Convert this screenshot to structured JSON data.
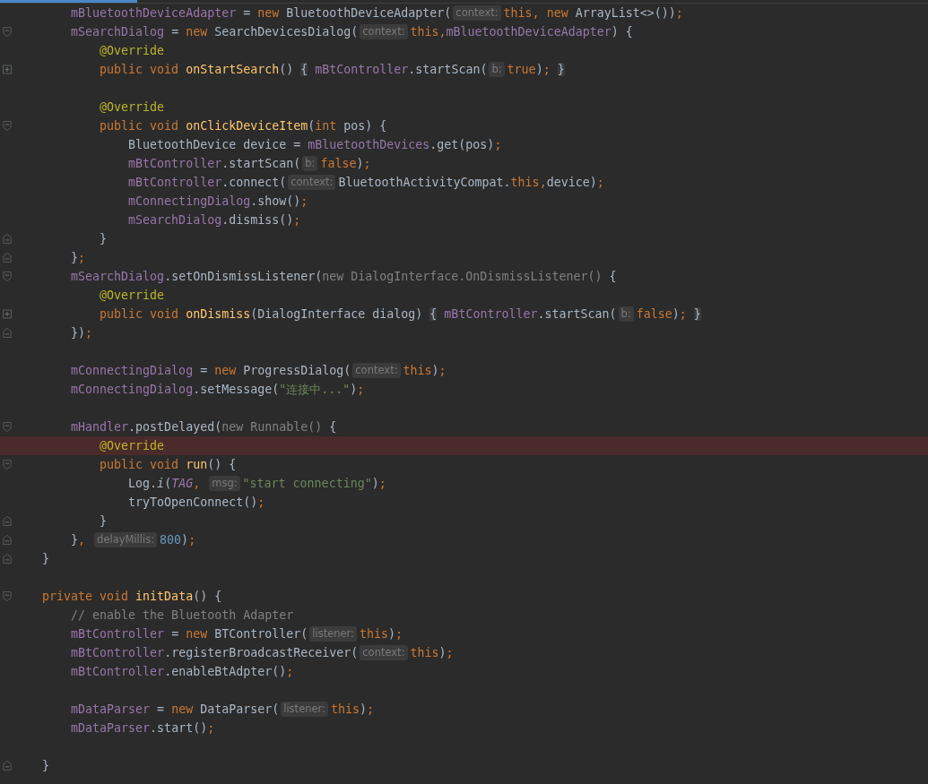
{
  "editor": {
    "lines": [
      {
        "highlighted": false,
        "tokens": [
          {
            "kind": "field",
            "text": "        mBluetoothDeviceAdapter"
          },
          {
            "kind": "plain",
            "text": " = "
          },
          {
            "kind": "keyword",
            "text": "new "
          },
          {
            "kind": "plain",
            "text": "BluetoothDeviceAdapter("
          },
          {
            "kind": "hint",
            "text": "context:"
          },
          {
            "kind": "keyword",
            "text": "this"
          },
          {
            "kind": "punct",
            "text": ", "
          },
          {
            "kind": "keyword",
            "text": "new "
          },
          {
            "kind": "plain",
            "text": "ArrayList<>())"
          },
          {
            "kind": "punct",
            "text": ";"
          }
        ]
      },
      {
        "fold_marker": {
          "kind": "start"
        },
        "highlighted": false,
        "tokens": [
          {
            "kind": "field",
            "text": "        mSearchDialog"
          },
          {
            "kind": "plain",
            "text": " = "
          },
          {
            "kind": "keyword",
            "text": "new "
          },
          {
            "kind": "plain",
            "text": "SearchDevicesDialog("
          },
          {
            "kind": "hint",
            "text": "context:"
          },
          {
            "kind": "keyword",
            "text": "this"
          },
          {
            "kind": "punct",
            "text": ","
          },
          {
            "kind": "field",
            "text": "mBluetoothDeviceAdapter"
          },
          {
            "kind": "plain",
            "text": ") {"
          }
        ]
      },
      {
        "highlighted": false,
        "tokens": [
          {
            "kind": "annotation",
            "text": "            @Override"
          }
        ]
      },
      {
        "fold_marker": {
          "kind": "collapsed"
        },
        "highlighted": false,
        "tokens": [
          {
            "kind": "keyword",
            "text": "            public void "
          },
          {
            "kind": "method",
            "text": "onStartSearch"
          },
          {
            "kind": "plain",
            "text": "() "
          },
          {
            "kind": "fold",
            "text": "{"
          },
          {
            "kind": "field",
            "text": " mBtController"
          },
          {
            "kind": "plain",
            "text": ".startScan("
          },
          {
            "kind": "hint",
            "text": "b:"
          },
          {
            "kind": "keyword",
            "text": "true"
          },
          {
            "kind": "plain",
            "text": ")"
          },
          {
            "kind": "punct",
            "text": "; "
          },
          {
            "kind": "fold",
            "text": "}"
          }
        ]
      },
      {
        "highlighted": false
      },
      {
        "highlighted": false,
        "tokens": [
          {
            "kind": "annotation",
            "text": "            @Override"
          }
        ]
      },
      {
        "fold_marker": {
          "kind": "start"
        },
        "highlighted": false,
        "tokens": [
          {
            "kind": "keyword",
            "text": "            public void "
          },
          {
            "kind": "method",
            "text": "onClickDeviceItem"
          },
          {
            "kind": "plain",
            "text": "("
          },
          {
            "kind": "keyword",
            "text": "int "
          },
          {
            "kind": "plain",
            "text": "pos) {"
          }
        ]
      },
      {
        "highlighted": false,
        "tokens": [
          {
            "kind": "plain",
            "text": "                BluetoothDevice device = "
          },
          {
            "kind": "field",
            "text": "mBluetoothDevices"
          },
          {
            "kind": "plain",
            "text": ".get(pos)"
          },
          {
            "kind": "punct",
            "text": ";"
          }
        ]
      },
      {
        "highlighted": false,
        "tokens": [
          {
            "kind": "field",
            "text": "                mBtController"
          },
          {
            "kind": "plain",
            "text": ".startScan("
          },
          {
            "kind": "hint",
            "text": "b:"
          },
          {
            "kind": "keyword",
            "text": "false"
          },
          {
            "kind": "plain",
            "text": ")"
          },
          {
            "kind": "punct",
            "text": ";"
          }
        ]
      },
      {
        "highlighted": false,
        "tokens": [
          {
            "kind": "field",
            "text": "                mBtController"
          },
          {
            "kind": "plain",
            "text": ".connect("
          },
          {
            "kind": "hint",
            "text": "context:"
          },
          {
            "kind": "plain",
            "text": "BluetoothActivityCompat."
          },
          {
            "kind": "keyword",
            "text": "this"
          },
          {
            "kind": "punct",
            "text": ","
          },
          {
            "kind": "plain",
            "text": "device)"
          },
          {
            "kind": "punct",
            "text": ";"
          }
        ]
      },
      {
        "highlighted": false,
        "tokens": [
          {
            "kind": "field",
            "text": "                mConnectingDialog"
          },
          {
            "kind": "plain",
            "text": ".show()"
          },
          {
            "kind": "punct",
            "text": ";"
          }
        ]
      },
      {
        "highlighted": false,
        "tokens": [
          {
            "kind": "field",
            "text": "                mSearchDialog"
          },
          {
            "kind": "plain",
            "text": ".dismiss()"
          },
          {
            "kind": "punct",
            "text": ";"
          }
        ]
      },
      {
        "fold_marker": {
          "kind": "end"
        },
        "highlighted": false,
        "tokens": [
          {
            "kind": "plain",
            "text": "            }"
          }
        ]
      },
      {
        "fold_marker": {
          "kind": "end"
        },
        "highlighted": false,
        "tokens": [
          {
            "kind": "plain",
            "text": "        }"
          },
          {
            "kind": "punct",
            "text": ";"
          }
        ]
      },
      {
        "fold_marker": {
          "kind": "start"
        },
        "highlighted": false,
        "tokens": [
          {
            "kind": "field",
            "text": "        mSearchDialog"
          },
          {
            "kind": "plain",
            "text": ".setOnDismissListener("
          },
          {
            "kind": "muted",
            "text": "new DialogInterface.OnDismissListener()"
          },
          {
            "kind": "plain",
            "text": " {"
          }
        ]
      },
      {
        "highlighted": false,
        "tokens": [
          {
            "kind": "annotation",
            "text": "            @Override"
          }
        ]
      },
      {
        "fold_marker": {
          "kind": "collapsed"
        },
        "highlighted": false,
        "tokens": [
          {
            "kind": "keyword",
            "text": "            public void "
          },
          {
            "kind": "method",
            "text": "onDismiss"
          },
          {
            "kind": "plain",
            "text": "(DialogInterface dialog) "
          },
          {
            "kind": "fold",
            "text": "{"
          },
          {
            "kind": "field",
            "text": " mBtController"
          },
          {
            "kind": "plain",
            "text": ".startScan("
          },
          {
            "kind": "hint",
            "text": "b:"
          },
          {
            "kind": "keyword",
            "text": "false"
          },
          {
            "kind": "plain",
            "text": ")"
          },
          {
            "kind": "punct",
            "text": "; "
          },
          {
            "kind": "fold",
            "text": "}"
          }
        ]
      },
      {
        "fold_marker": {
          "kind": "end"
        },
        "highlighted": false,
        "tokens": [
          {
            "kind": "plain",
            "text": "        })"
          },
          {
            "kind": "punct",
            "text": ";"
          }
        ]
      },
      {
        "highlighted": false
      },
      {
        "highlighted": false,
        "tokens": [
          {
            "kind": "field",
            "text": "        mConnectingDialog"
          },
          {
            "kind": "plain",
            "text": " = "
          },
          {
            "kind": "keyword",
            "text": "new "
          },
          {
            "kind": "plain",
            "text": "ProgressDialog("
          },
          {
            "kind": "hint",
            "text": "context:"
          },
          {
            "kind": "keyword",
            "text": "this"
          },
          {
            "kind": "plain",
            "text": ")"
          },
          {
            "kind": "punct",
            "text": ";"
          }
        ]
      },
      {
        "highlighted": false,
        "tokens": [
          {
            "kind": "field",
            "text": "        mConnectingDialog"
          },
          {
            "kind": "plain",
            "text": ".setMessage("
          },
          {
            "kind": "string",
            "text": "\"连接中...\""
          },
          {
            "kind": "plain",
            "text": ")"
          },
          {
            "kind": "punct",
            "text": ";"
          }
        ]
      },
      {
        "highlighted": false
      },
      {
        "fold_marker": {
          "kind": "start"
        },
        "highlighted": false,
        "tokens": [
          {
            "kind": "field",
            "text": "        mHandler"
          },
          {
            "kind": "plain",
            "text": ".postDelayed("
          },
          {
            "kind": "muted",
            "text": "new Runnable()"
          },
          {
            "kind": "plain",
            "text": " {"
          }
        ]
      },
      {
        "highlighted": true,
        "tokens": [
          {
            "kind": "annotation",
            "text": "            @Override"
          }
        ]
      },
      {
        "fold_marker": {
          "kind": "start"
        },
        "highlighted": false,
        "tokens": [
          {
            "kind": "keyword",
            "text": "            public void "
          },
          {
            "kind": "method",
            "text": "run"
          },
          {
            "kind": "plain",
            "text": "() {"
          }
        ]
      },
      {
        "highlighted": false,
        "tokens": [
          {
            "kind": "plain",
            "text": "                Log."
          },
          {
            "kind": "static",
            "text": "i"
          },
          {
            "kind": "plain",
            "text": "("
          },
          {
            "kind": "constant",
            "text": "TAG"
          },
          {
            "kind": "punct",
            "text": ", "
          },
          {
            "kind": "hint",
            "text": "msg:"
          },
          {
            "kind": "string",
            "text": "\"start connecting\""
          },
          {
            "kind": "plain",
            "text": ")"
          },
          {
            "kind": "punct",
            "text": ";"
          }
        ]
      },
      {
        "highlighted": false,
        "tokens": [
          {
            "kind": "plain",
            "text": "                tryToOpenConnect()"
          },
          {
            "kind": "punct",
            "text": ";"
          }
        ]
      },
      {
        "fold_marker": {
          "kind": "end"
        },
        "highlighted": false,
        "tokens": [
          {
            "kind": "plain",
            "text": "            }"
          }
        ]
      },
      {
        "fold_marker": {
          "kind": "end"
        },
        "highlighted": false,
        "tokens": [
          {
            "kind": "plain",
            "text": "        }"
          },
          {
            "kind": "punct",
            "text": ", "
          },
          {
            "kind": "hint",
            "text": "delayMillis:"
          },
          {
            "kind": "number",
            "text": "800"
          },
          {
            "kind": "plain",
            "text": ")"
          },
          {
            "kind": "punct",
            "text": ";"
          }
        ]
      },
      {
        "fold_marker": {
          "kind": "end"
        },
        "highlighted": false,
        "tokens": [
          {
            "kind": "plain",
            "text": "    }"
          }
        ]
      },
      {
        "highlighted": false
      },
      {
        "fold_marker": {
          "kind": "start"
        },
        "highlighted": false,
        "tokens": [
          {
            "kind": "keyword",
            "text": "    private void "
          },
          {
            "kind": "method",
            "text": "initData"
          },
          {
            "kind": "plain",
            "text": "() {"
          }
        ]
      },
      {
        "highlighted": false,
        "tokens": [
          {
            "kind": "comment",
            "text": "        // enable the Bluetooth Adapter"
          }
        ]
      },
      {
        "highlighted": false,
        "tokens": [
          {
            "kind": "field",
            "text": "        mBtController"
          },
          {
            "kind": "plain",
            "text": " = "
          },
          {
            "kind": "keyword",
            "text": "new "
          },
          {
            "kind": "plain",
            "text": "BTController("
          },
          {
            "kind": "hint",
            "text": "listener:"
          },
          {
            "kind": "keyword",
            "text": "this"
          },
          {
            "kind": "plain",
            "text": ")"
          },
          {
            "kind": "punct",
            "text": ";"
          }
        ]
      },
      {
        "highlighted": false,
        "tokens": [
          {
            "kind": "field",
            "text": "        mBtController"
          },
          {
            "kind": "plain",
            "text": ".registerBroadcastReceiver("
          },
          {
            "kind": "hint",
            "text": "context:"
          },
          {
            "kind": "keyword",
            "text": "this"
          },
          {
            "kind": "plain",
            "text": ")"
          },
          {
            "kind": "punct",
            "text": ";"
          }
        ]
      },
      {
        "highlighted": false,
        "tokens": [
          {
            "kind": "field",
            "text": "        mBtController"
          },
          {
            "kind": "plain",
            "text": ".enableBtAdpter()"
          },
          {
            "kind": "punct",
            "text": ";"
          }
        ]
      },
      {
        "highlighted": false
      },
      {
        "highlighted": false,
        "tokens": [
          {
            "kind": "field",
            "text": "        mDataParser"
          },
          {
            "kind": "plain",
            "text": " = "
          },
          {
            "kind": "keyword",
            "text": "new "
          },
          {
            "kind": "plain",
            "text": "DataParser("
          },
          {
            "kind": "hint",
            "text": "listener:"
          },
          {
            "kind": "keyword",
            "text": "this"
          },
          {
            "kind": "plain",
            "text": ")"
          },
          {
            "kind": "punct",
            "text": ";"
          }
        ]
      },
      {
        "highlighted": false,
        "tokens": [
          {
            "kind": "field",
            "text": "        mDataParser"
          },
          {
            "kind": "plain",
            "text": ".start()"
          },
          {
            "kind": "punct",
            "text": ";"
          }
        ]
      },
      {
        "highlighted": false
      },
      {
        "fold_marker": {
          "kind": "end"
        },
        "highlighted": false,
        "tokens": [
          {
            "kind": "plain",
            "text": "    }"
          }
        ]
      }
    ]
  }
}
